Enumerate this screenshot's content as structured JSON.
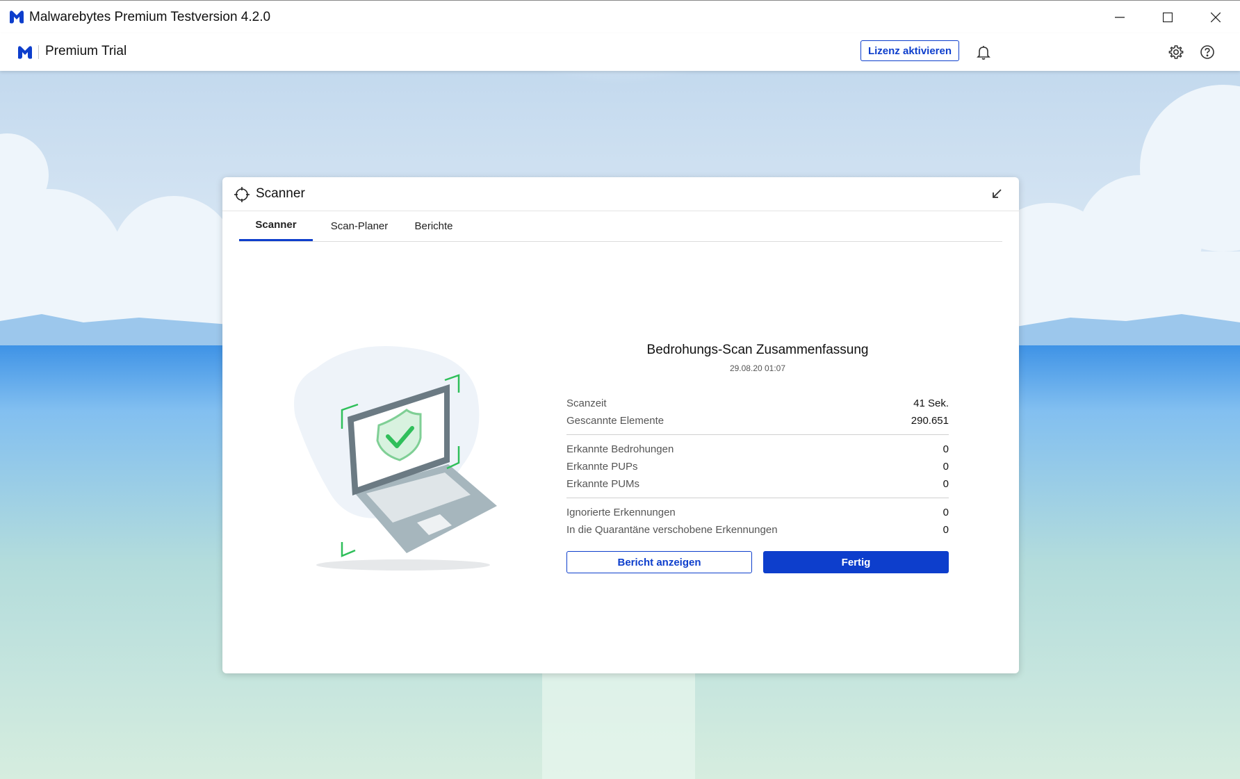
{
  "window": {
    "title": "Malwarebytes Premium Testversion  4.2.0"
  },
  "header": {
    "product_label": "Premium Trial",
    "license_button": "Lizenz aktivieren"
  },
  "scanner_card": {
    "title": "Scanner",
    "tabs": [
      {
        "label": "Scanner",
        "active": true
      },
      {
        "label": "Scan-Planer",
        "active": false
      },
      {
        "label": "Berichte",
        "active": false
      }
    ]
  },
  "summary": {
    "heading": "Bedrohungs-Scan Zusammenfassung",
    "date": "29.08.20 01:07",
    "groups": [
      [
        {
          "label": "Scanzeit",
          "value": "41 Sek."
        },
        {
          "label": "Gescannte Elemente",
          "value": "290.651"
        }
      ],
      [
        {
          "label": "Erkannte Bedrohungen",
          "value": "0"
        },
        {
          "label": "Erkannte PUPs",
          "value": "0"
        },
        {
          "label": "Erkannte PUMs",
          "value": "0"
        }
      ],
      [
        {
          "label": "Ignorierte Erkennungen",
          "value": "0"
        },
        {
          "label": "In die Quarantäne verschobene Erkennungen",
          "value": "0"
        }
      ]
    ],
    "report_button": "Bericht anzeigen",
    "done_button": "Fertig"
  },
  "colors": {
    "brand_blue": "#0d3ecc",
    "shield_green": "#2fbf5a"
  }
}
